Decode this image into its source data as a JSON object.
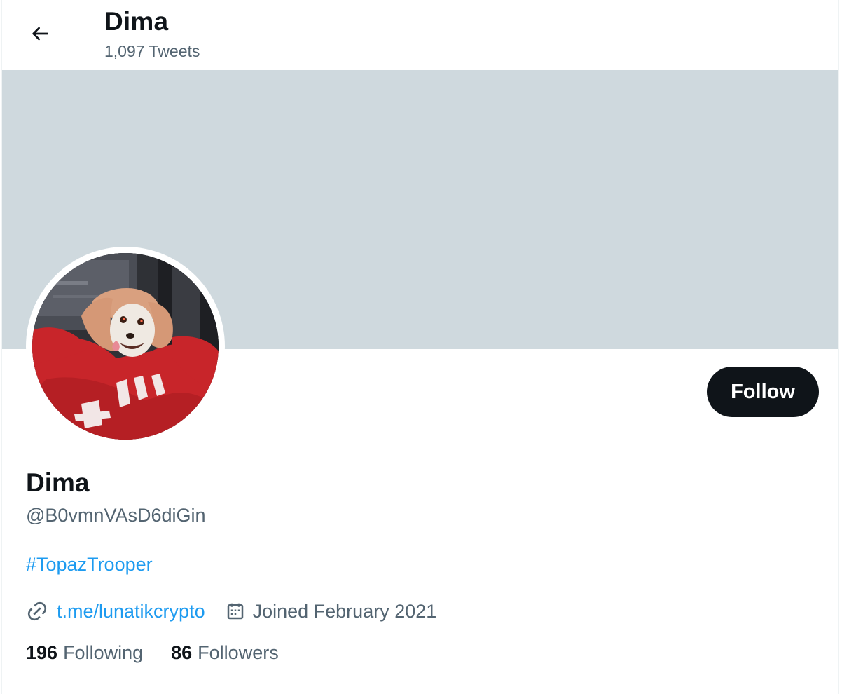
{
  "header": {
    "title": "Dima",
    "tweet_count": "1,097 Tweets",
    "back_icon": "arrow-left-icon"
  },
  "profile": {
    "display_name": "Dima",
    "handle": "@B0vmnVAsD6diGin",
    "bio": "#TopazTrooper",
    "link": "t.me/lunatikcrypto",
    "joined": "Joined February 2021",
    "avatar": "chihuahua-in-red-hoodie-avatar",
    "banner_color": "#cfd9de"
  },
  "actions": {
    "follow_label": "Follow"
  },
  "stats": {
    "following_count": "196",
    "following_label": "Following",
    "followers_count": "86",
    "followers_label": "Followers"
  },
  "colors": {
    "link_blue": "#1d9bf0",
    "text_primary": "#0f1419",
    "text_secondary": "#536471"
  },
  "icons": {
    "link_icon": "link-icon",
    "calendar_icon": "calendar-icon"
  }
}
